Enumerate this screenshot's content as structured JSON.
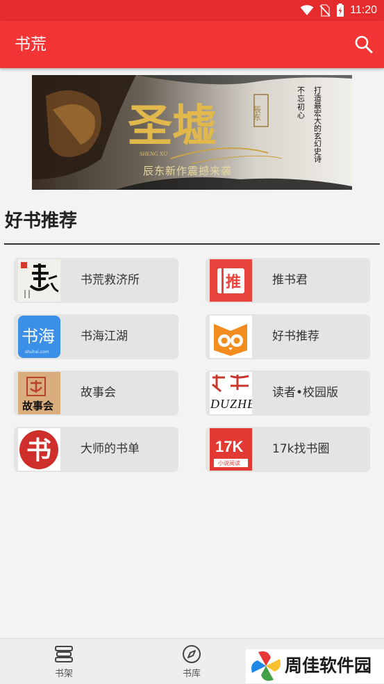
{
  "status_bar": {
    "time": "11:20"
  },
  "app_bar": {
    "title": "书荒",
    "search_icon": "search-icon"
  },
  "banner": {
    "title": "圣墟",
    "subtitle_roman": "SHENG XU",
    "author_seal": "辰东",
    "tagline": "辰东新作震撼来袭",
    "slogan_left": "不忘初心",
    "slogan_right": "打造最宏大的玄幻史诗"
  },
  "section": {
    "title": "好书推荐"
  },
  "cards": [
    {
      "label": "书荒救济所",
      "icon": "shuhuang-logo-icon"
    },
    {
      "label": "推书君",
      "icon": "tui-logo-icon"
    },
    {
      "label": "书海江湖",
      "icon": "shuhai-logo-icon",
      "icon_text": "书海",
      "icon_sub": "shuhai.com"
    },
    {
      "label": "好书推荐",
      "icon": "owl-book-icon"
    },
    {
      "label": "故事会",
      "icon": "gushihui-logo-icon",
      "icon_text": "故事会"
    },
    {
      "label": "读者•校园版",
      "icon": "duzhe-logo-icon",
      "icon_text": "DUZHE"
    },
    {
      "label": "大师的书单",
      "icon": "dashi-logo-icon",
      "icon_text": "书"
    },
    {
      "label": "17k找书圈",
      "icon": "17k-logo-icon",
      "icon_text": "17K",
      "icon_sub": "小说阅读"
    }
  ],
  "bottom_nav": [
    {
      "label": "书架",
      "icon": "bookshelf-icon"
    },
    {
      "label": "书库",
      "icon": "compass-icon"
    }
  ],
  "watermark": {
    "text": "周佳软件园"
  },
  "colors": {
    "primary": "#f23434",
    "status_bar": "#e52b2b",
    "card_bg": "#e4e4e4",
    "page_bg": "#f3f3f3"
  }
}
